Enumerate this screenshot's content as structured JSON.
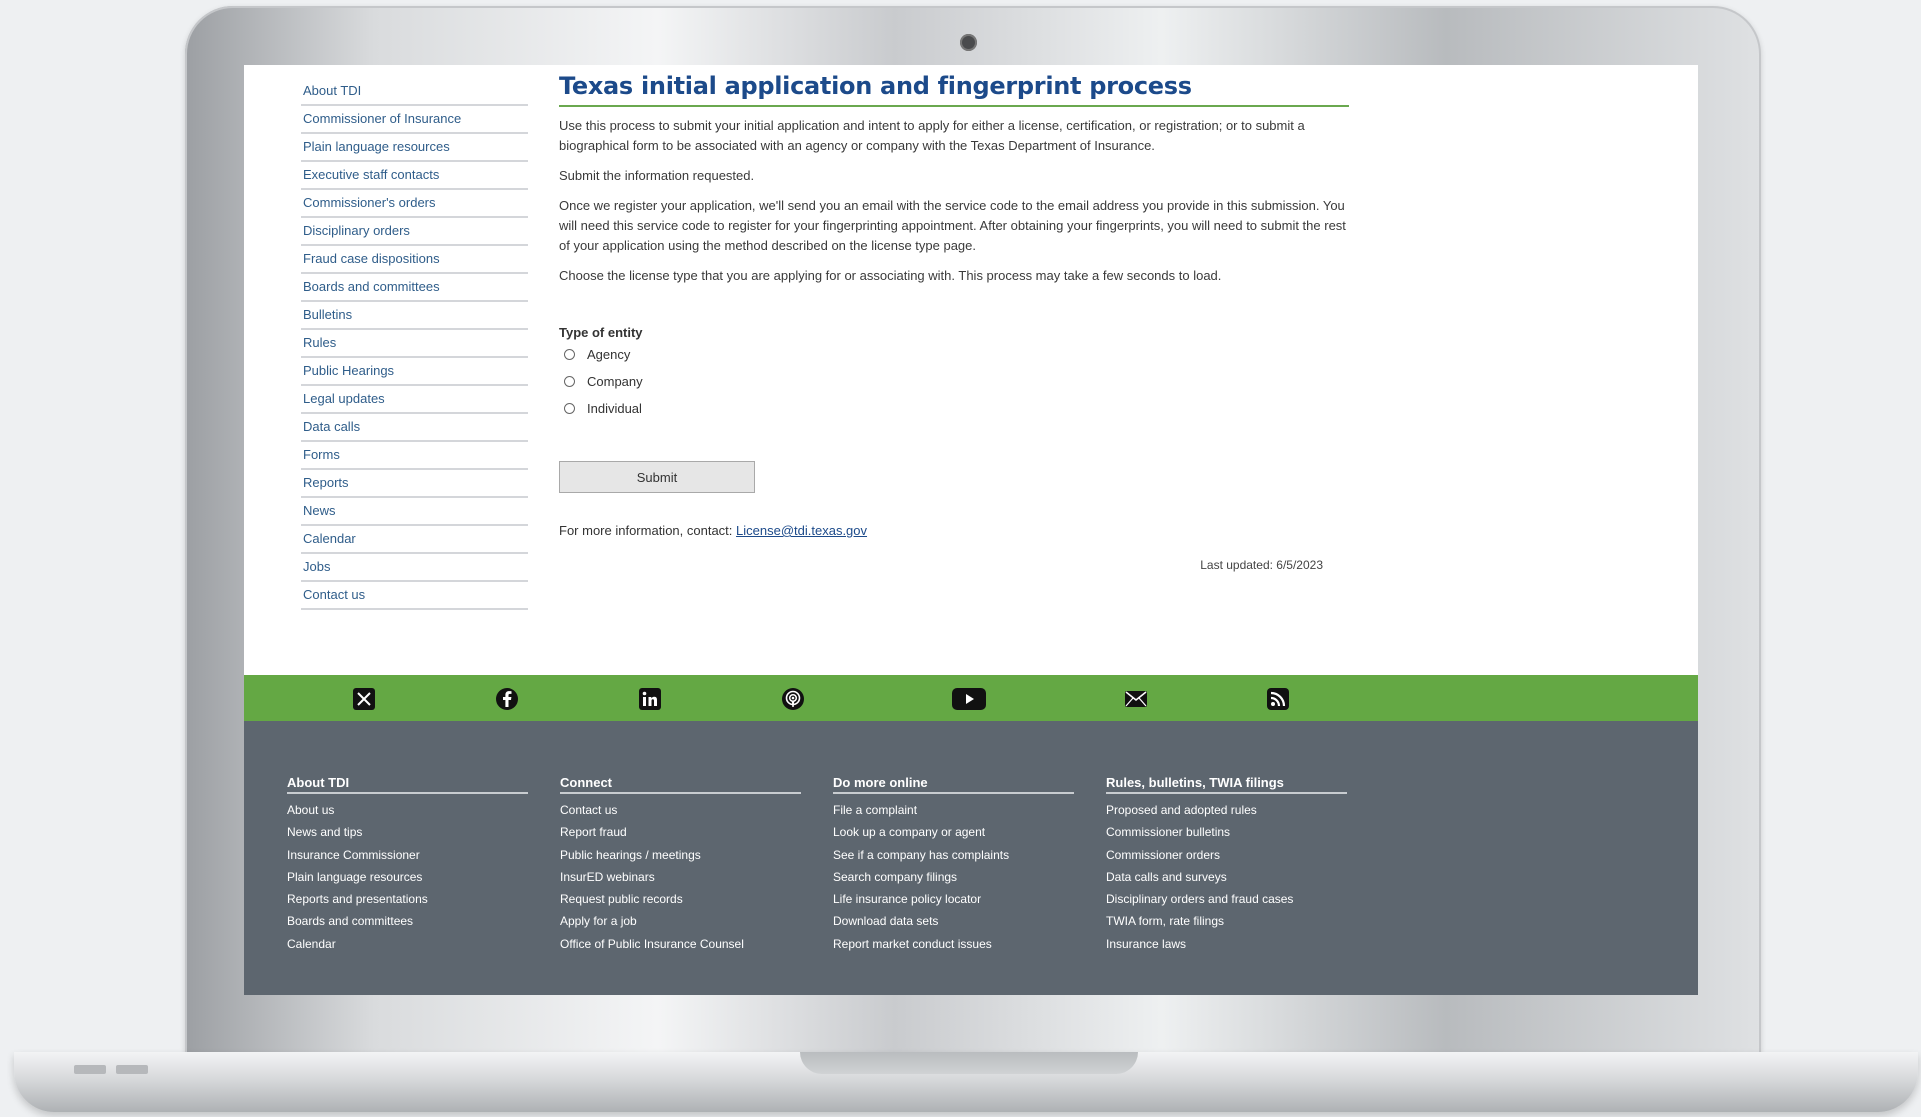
{
  "sidebar": {
    "items": [
      {
        "label": "About TDI"
      },
      {
        "label": "Commissioner of Insurance"
      },
      {
        "label": "Plain language resources"
      },
      {
        "label": "Executive staff contacts"
      },
      {
        "label": "Commissioner's orders"
      },
      {
        "label": "Disciplinary orders"
      },
      {
        "label": "Fraud case dispositions"
      },
      {
        "label": "Boards and committees"
      },
      {
        "label": "Bulletins"
      },
      {
        "label": "Rules"
      },
      {
        "label": "Public Hearings"
      },
      {
        "label": "Legal updates"
      },
      {
        "label": "Data calls"
      },
      {
        "label": "Forms"
      },
      {
        "label": "Reports"
      },
      {
        "label": "News"
      },
      {
        "label": "Calendar"
      },
      {
        "label": "Jobs"
      },
      {
        "label": "Contact us"
      }
    ]
  },
  "main": {
    "title": "Texas initial application and fingerprint process",
    "paragraphs": [
      "Use this process to submit your initial application and intent to apply for either a license, certification, or registration; or to submit a biographical form to be associated with an agency or company with the Texas Department of Insurance.",
      "Submit the information requested.",
      "Once we register your application, we'll send you an email with the service code to the email address you provide in this submission. You will need this service code to register for your fingerprinting appointment. After obtaining your fingerprints, you will need to submit the rest of your application using the method described on the license type page.",
      "Choose the license type that you are applying for or associating with. This process may take a few seconds to load."
    ],
    "entity_label": "Type of entity",
    "entity_options": [
      {
        "label": "Agency",
        "checked": false
      },
      {
        "label": "Company",
        "checked": false
      },
      {
        "label": "Individual",
        "checked": false
      }
    ],
    "submit_label": "Submit",
    "contact_prefix": "For more information, contact:",
    "contact_email": "License@tdi.texas.gov",
    "last_updated": "Last updated: 6/5/2023"
  },
  "social": {
    "icons": [
      "x-icon",
      "facebook-icon",
      "linkedin-icon",
      "podcast-icon",
      "youtube-icon",
      "email-icon",
      "rss-icon"
    ]
  },
  "footer": {
    "columns": [
      {
        "heading": "About TDI",
        "links": [
          "About us",
          "News and tips",
          "Insurance Commissioner",
          "Plain language resources",
          "Reports and presentations",
          "Boards and committees",
          "Calendar"
        ]
      },
      {
        "heading": "Connect",
        "links": [
          "Contact us",
          "Report fraud",
          "Public hearings / meetings",
          "InsurED webinars",
          "Request public records",
          "Apply for a job",
          "Office of Public Insurance Counsel"
        ]
      },
      {
        "heading": "Do more online",
        "links": [
          "File a complaint",
          "Look up a company or agent",
          "See if a company has complaints",
          "Search company filings",
          "Life insurance policy locator",
          "Download data sets",
          "Report market conduct issues"
        ]
      },
      {
        "heading": "Rules, bulletins, TWIA filings",
        "links": [
          "Proposed and adopted rules",
          "Commissioner bulletins",
          "Commissioner orders",
          "Data calls and surveys",
          "Disciplinary orders and fraud cases",
          "TWIA form, rate filings",
          "Insurance laws"
        ]
      }
    ]
  },
  "colors": {
    "title": "#1c4a8a",
    "link": "#2f5d8a",
    "social_bar": "#64a844",
    "footer_bg": "#5d666f"
  }
}
